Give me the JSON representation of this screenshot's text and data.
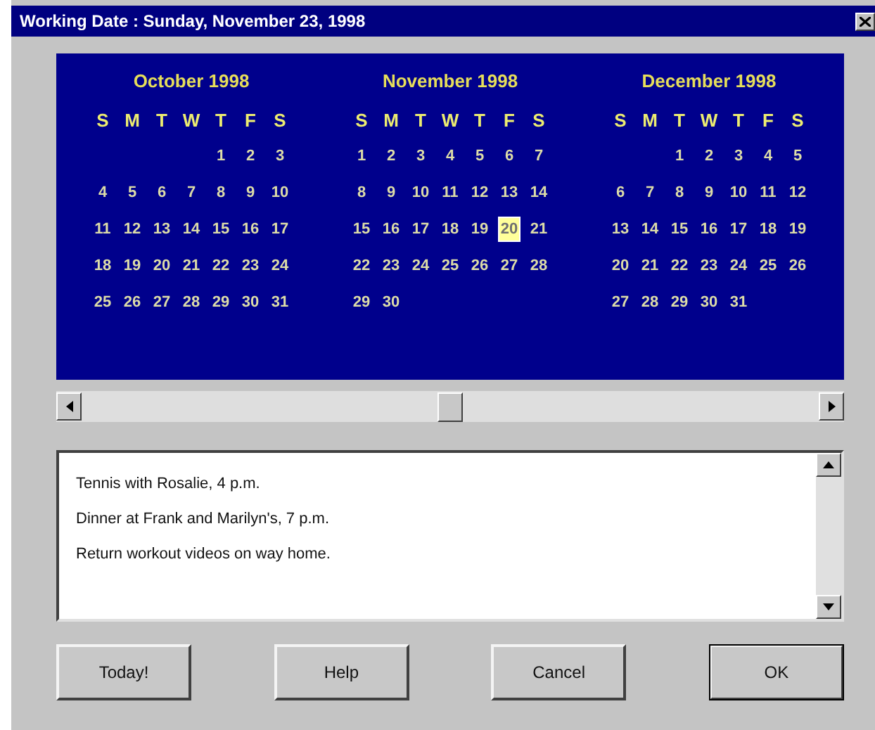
{
  "window": {
    "title": "Working Date : Sunday, November 23, 1998"
  },
  "months": [
    {
      "name": "October 1998",
      "weekdays": [
        "S",
        "M",
        "T",
        "W",
        "T",
        "F",
        "S"
      ],
      "weeks": [
        [
          {
            "day": "1",
            "selected": false
          },
          {
            "day": "2",
            "selected": false
          },
          {
            "day": "3",
            "selected": false
          }
        ],
        [
          {
            "day": "4",
            "selected": false
          },
          {
            "day": "5",
            "selected": false
          },
          {
            "day": "6",
            "selected": false
          },
          {
            "day": "7",
            "selected": false
          },
          {
            "day": "8",
            "selected": false
          },
          {
            "day": "9",
            "selected": false
          },
          {
            "day": "10",
            "selected": false
          }
        ],
        [
          {
            "day": "11",
            "selected": false
          },
          {
            "day": "12",
            "selected": false
          },
          {
            "day": "13",
            "selected": false
          },
          {
            "day": "14",
            "selected": false
          },
          {
            "day": "15",
            "selected": false
          },
          {
            "day": "16",
            "selected": false
          },
          {
            "day": "17",
            "selected": false
          }
        ],
        [
          {
            "day": "18",
            "selected": false
          },
          {
            "day": "19",
            "selected": false
          },
          {
            "day": "20",
            "selected": false
          },
          {
            "day": "21",
            "selected": false
          },
          {
            "day": "22",
            "selected": false
          },
          {
            "day": "23",
            "selected": false
          },
          {
            "day": "24",
            "selected": false
          }
        ],
        [
          {
            "day": "25",
            "selected": false
          },
          {
            "day": "26",
            "selected": false
          },
          {
            "day": "27",
            "selected": false
          },
          {
            "day": "28",
            "selected": false
          },
          {
            "day": "29",
            "selected": false
          },
          {
            "day": "30",
            "selected": false
          },
          {
            "day": "31",
            "selected": false
          }
        ]
      ]
    },
    {
      "name": "November 1998",
      "weekdays": [
        "S",
        "M",
        "T",
        "W",
        "T",
        "F",
        "S"
      ],
      "weeks": [
        [
          {
            "day": "1",
            "selected": false
          },
          {
            "day": "2",
            "selected": false
          },
          {
            "day": "3",
            "selected": false
          },
          {
            "day": "4",
            "selected": false
          },
          {
            "day": "5",
            "selected": false
          },
          {
            "day": "6",
            "selected": false
          },
          {
            "day": "7",
            "selected": false
          }
        ],
        [
          {
            "day": "8",
            "selected": false
          },
          {
            "day": "9",
            "selected": false
          },
          {
            "day": "10",
            "selected": false
          },
          {
            "day": "11",
            "selected": false
          },
          {
            "day": "12",
            "selected": false
          },
          {
            "day": "13",
            "selected": false
          },
          {
            "day": "14",
            "selected": false
          }
        ],
        [
          {
            "day": "15",
            "selected": false
          },
          {
            "day": "16",
            "selected": false
          },
          {
            "day": "17",
            "selected": false
          },
          {
            "day": "18",
            "selected": false
          },
          {
            "day": "19",
            "selected": false
          },
          {
            "day": "20",
            "selected": true
          },
          {
            "day": "21",
            "selected": false
          }
        ],
        [
          {
            "day": "22",
            "selected": false
          },
          {
            "day": "23",
            "selected": false
          },
          {
            "day": "24",
            "selected": false
          },
          {
            "day": "25",
            "selected": false
          },
          {
            "day": "26",
            "selected": false
          },
          {
            "day": "27",
            "selected": false
          },
          {
            "day": "28",
            "selected": false
          }
        ],
        [
          {
            "day": "29",
            "selected": false
          },
          {
            "day": "30",
            "selected": false
          }
        ]
      ]
    },
    {
      "name": "December 1998",
      "weekdays": [
        "S",
        "M",
        "T",
        "W",
        "T",
        "F",
        "S"
      ],
      "weeks": [
        [
          {
            "day": "1",
            "selected": false
          },
          {
            "day": "2",
            "selected": false
          },
          {
            "day": "3",
            "selected": false
          },
          {
            "day": "4",
            "selected": false
          },
          {
            "day": "5",
            "selected": false
          }
        ],
        [
          {
            "day": "6",
            "selected": false
          },
          {
            "day": "7",
            "selected": false
          },
          {
            "day": "8",
            "selected": false
          },
          {
            "day": "9",
            "selected": false
          },
          {
            "day": "10",
            "selected": false
          },
          {
            "day": "11",
            "selected": false
          },
          {
            "day": "12",
            "selected": false
          }
        ],
        [
          {
            "day": "13",
            "selected": false
          },
          {
            "day": "14",
            "selected": false
          },
          {
            "day": "15",
            "selected": false
          },
          {
            "day": "16",
            "selected": false
          },
          {
            "day": "17",
            "selected": false
          },
          {
            "day": "18",
            "selected": false
          },
          {
            "day": "19",
            "selected": false
          }
        ],
        [
          {
            "day": "20",
            "selected": false
          },
          {
            "day": "21",
            "selected": false
          },
          {
            "day": "22",
            "selected": false
          },
          {
            "day": "23",
            "selected": false
          },
          {
            "day": "24",
            "selected": false
          },
          {
            "day": "25",
            "selected": false
          },
          {
            "day": "26",
            "selected": false
          }
        ],
        [
          {
            "day": "27",
            "selected": false
          },
          {
            "day": "28",
            "selected": false
          },
          {
            "day": "29",
            "selected": false
          },
          {
            "day": "30",
            "selected": false
          },
          {
            "day": "31",
            "selected": false
          }
        ]
      ]
    }
  ],
  "notes": [
    "Tennis with Rosalie, 4 p.m.",
    "Dinner at Frank and Marilyn's, 7 p.m.",
    "Return workout videos on way home."
  ],
  "buttons": [
    {
      "label": "Today!",
      "default": false
    },
    {
      "label": "Help",
      "default": false
    },
    {
      "label": "Cancel",
      "default": false
    },
    {
      "label": "OK",
      "default": true
    }
  ]
}
